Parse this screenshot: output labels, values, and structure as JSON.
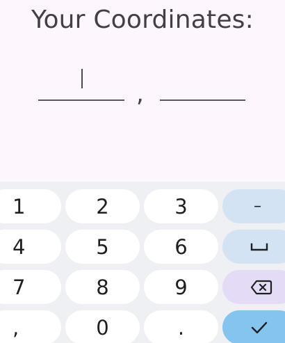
{
  "header": {
    "title": "Your Coordinates:"
  },
  "form": {
    "separator": ",",
    "latitude_value": "",
    "longitude_value": ""
  },
  "keyboard": {
    "rows": [
      [
        "1",
        "2",
        "3"
      ],
      [
        "4",
        "5",
        "6"
      ],
      [
        "7",
        "8",
        "9"
      ],
      [
        ",",
        "0",
        "."
      ]
    ],
    "function_keys": {
      "minus": "–",
      "space": "space-icon",
      "backspace": "backspace-icon",
      "done": "checkmark-icon"
    },
    "colors": {
      "background": "#eef0f3",
      "key": "#ffffff",
      "function_key": "#d3e3f4",
      "backspace_key": "#e4dcf6",
      "done_key": "#84c4ee"
    }
  }
}
